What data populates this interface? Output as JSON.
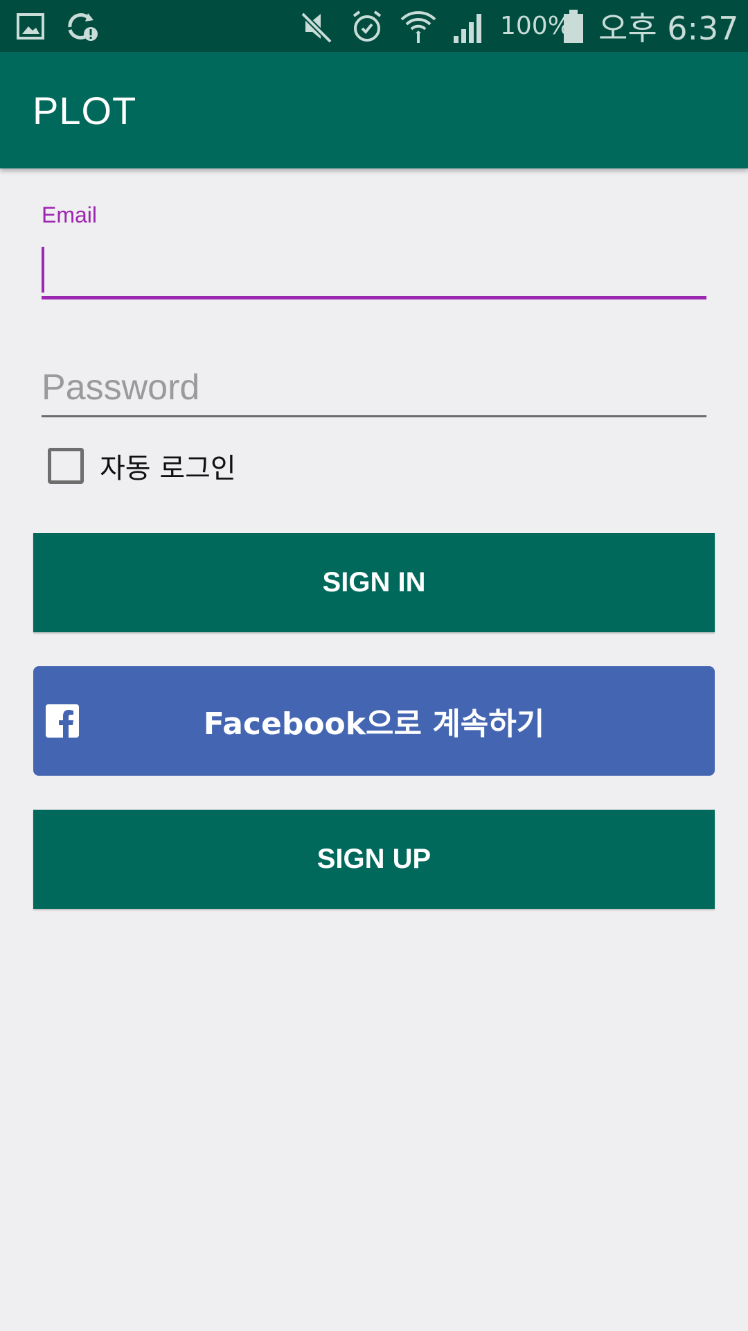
{
  "status_bar": {
    "battery": "100%",
    "time": "오후 6:37",
    "icons": [
      "gallery-icon",
      "sync-alert-icon",
      "mute-icon",
      "alarm-icon",
      "wifi-icon",
      "signal-icon",
      "battery-icon"
    ]
  },
  "app_bar": {
    "title": "PLOT"
  },
  "form": {
    "email_label": "Email",
    "email_value": "",
    "password_placeholder": "Password",
    "password_value": "",
    "auto_login_label": "자동 로그인",
    "auto_login_checked": false
  },
  "buttons": {
    "sign_in": "SIGN IN",
    "facebook": "Facebook으로 계속하기",
    "sign_up": "SIGN UP"
  },
  "colors": {
    "status_bar": "#004d40",
    "primary": "#00695c",
    "accent": "#9c27b0",
    "facebook": "#4466b2",
    "background": "#efeef0"
  }
}
